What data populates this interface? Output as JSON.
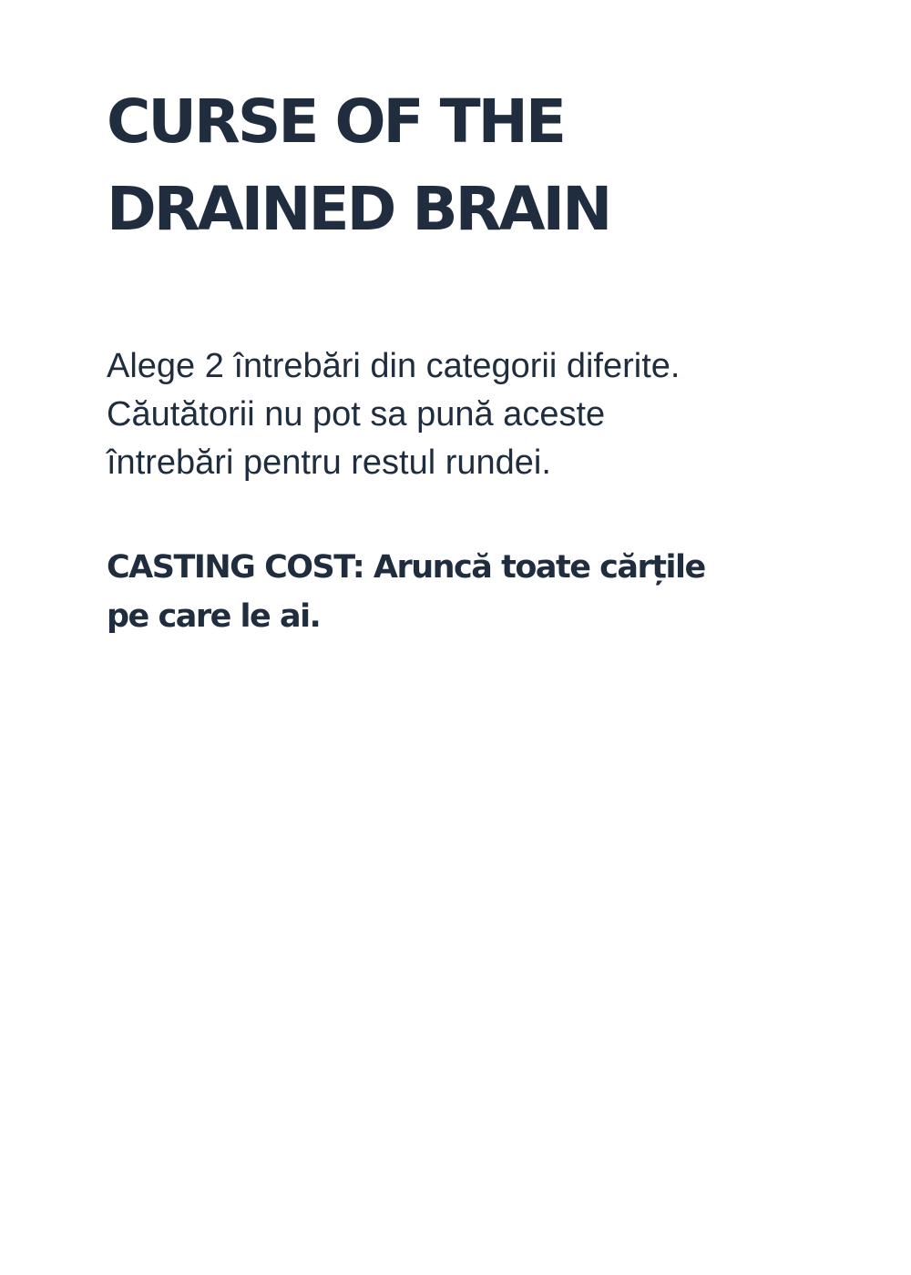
{
  "card": {
    "title_lines": [
      "CURSE OF THE",
      "DRAINED BRAIN"
    ],
    "description_lines": [
      "Alege 2 întrebări din categorii diferite.",
      "Căutătorii nu pot sa pună aceste",
      "întrebări pentru restul rundei."
    ],
    "casting_cost_lines": [
      "CASTING COST: Aruncă toate cărțile",
      "pe care le ai."
    ]
  },
  "colors": {
    "text": "#1f2d3f",
    "background": "#ffffff"
  }
}
